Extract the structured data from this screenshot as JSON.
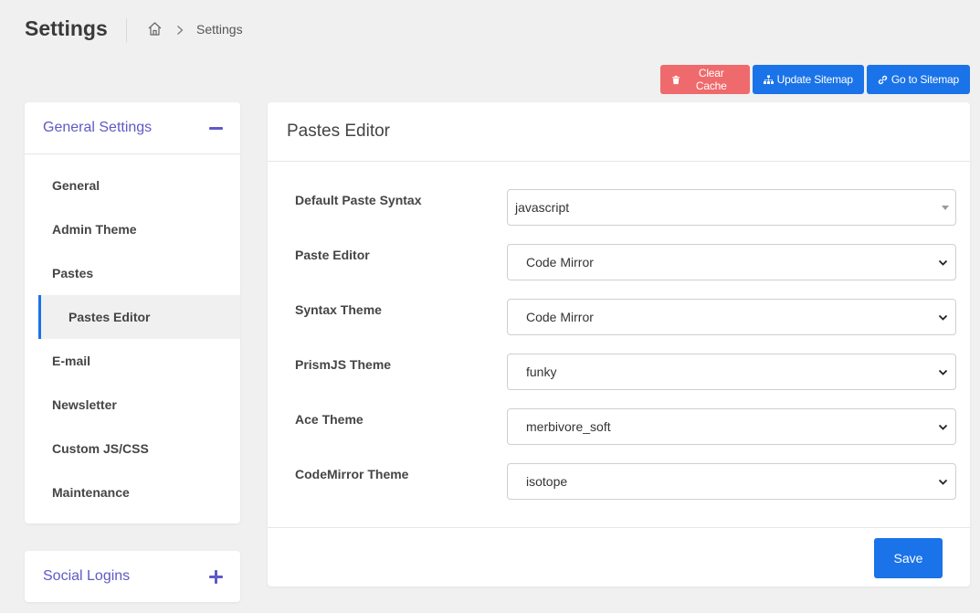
{
  "page": {
    "title": "Settings"
  },
  "breadcrumb": {
    "current": "Settings"
  },
  "actions": {
    "clear_cache": "Clear Cache",
    "update_sitemap": "Update Sitemap",
    "go_to_sitemap": "Go to Sitemap"
  },
  "sidebar": {
    "title": "General Settings",
    "items": [
      {
        "label": "General"
      },
      {
        "label": "Admin Theme"
      },
      {
        "label": "Pastes"
      },
      {
        "label": "Pastes Editor",
        "active": true
      },
      {
        "label": "E-mail"
      },
      {
        "label": "Newsletter"
      },
      {
        "label": "Custom JS/CSS"
      },
      {
        "label": "Maintenance"
      }
    ]
  },
  "social": {
    "title": "Social Logins"
  },
  "main": {
    "title": "Pastes Editor",
    "fields": [
      {
        "label": "Default Paste Syntax",
        "value": "javascript"
      },
      {
        "label": "Paste Editor",
        "value": "Code Mirror"
      },
      {
        "label": "Syntax Theme",
        "value": "Code Mirror"
      },
      {
        "label": "PrismJS Theme",
        "value": "funky"
      },
      {
        "label": "Ace Theme",
        "value": "merbivore_soft"
      },
      {
        "label": "CodeMirror Theme",
        "value": "isotope"
      }
    ],
    "save_label": "Save"
  },
  "colors": {
    "accent": "#1a73e8",
    "danger": "#ef6a6c",
    "sidebar_heading": "#5f59c6"
  }
}
